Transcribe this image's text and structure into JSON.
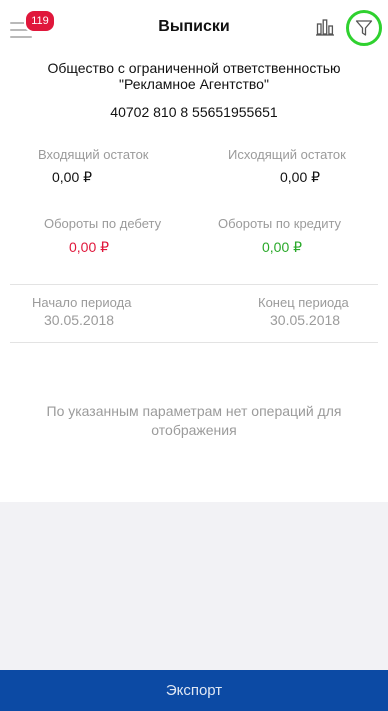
{
  "header": {
    "title": "Выписки",
    "badge_count": "119",
    "icons": {
      "menu": "menu-icon",
      "chart": "bar-chart-icon",
      "filter": "filter-icon"
    },
    "filter_highlight_color": "#2fd12f"
  },
  "account": {
    "company_line1": "Общество с ограниченной ответственностью",
    "company_line2": "\"Рекламное Агентство\"",
    "number": "40702 810 8 55651955651"
  },
  "balances": {
    "incoming_label": "Входящий остаток",
    "incoming_value": "0,00 ₽",
    "outgoing_label": "Исходящий остаток",
    "outgoing_value": "0,00 ₽",
    "debit_label": "Обороты по дебету",
    "debit_value": "0,00 ₽",
    "credit_label": "Обороты по кредиту",
    "credit_value": "0,00 ₽",
    "debit_color": "#e0173b",
    "credit_color": "#2aa92a"
  },
  "period": {
    "start_label": "Начало периода",
    "start_date": "30.05.2018",
    "end_label": "Конец периода",
    "end_date": "30.05.2018"
  },
  "empty_message_line1": "По указанным параметрам нет операций для",
  "empty_message_line2": "отображения",
  "export_label": "Экспорт",
  "colors": {
    "accent_blue": "#0c4aa4",
    "badge_red": "#e0173b"
  }
}
